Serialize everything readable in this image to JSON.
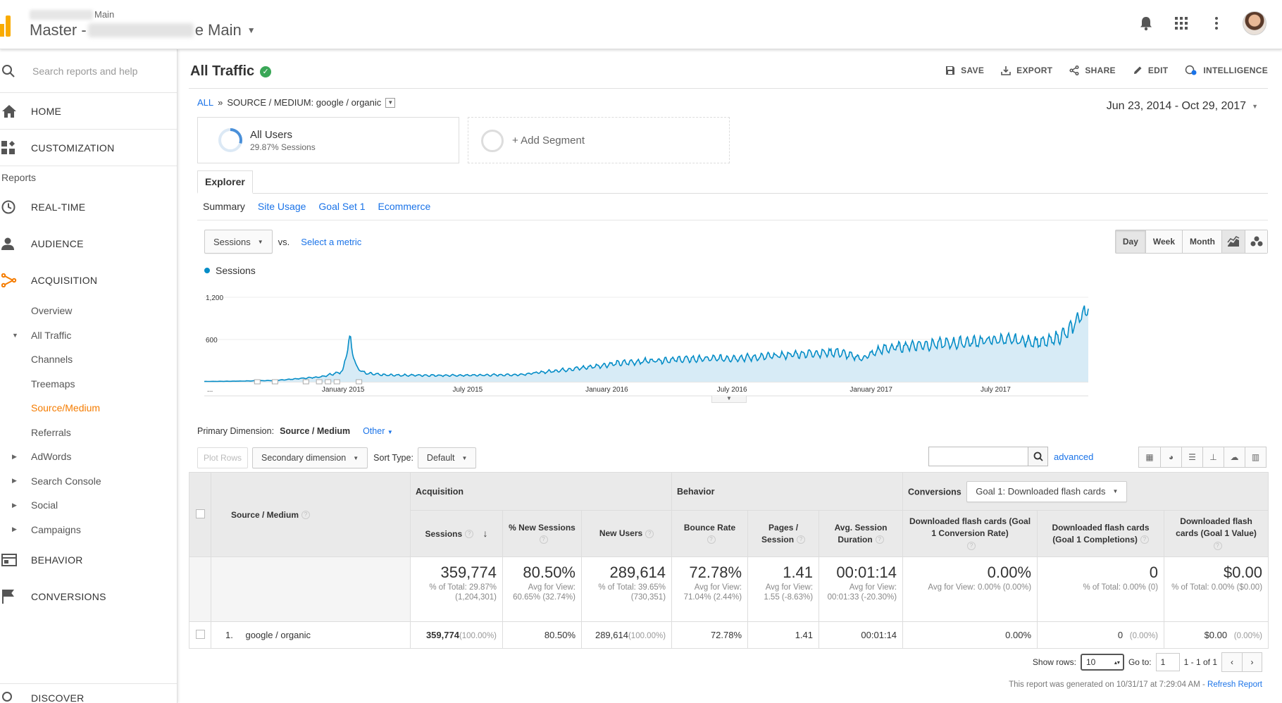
{
  "account": {
    "property_small": "Main",
    "view_prefix": "Master -",
    "view_suffix": "e Main"
  },
  "sidebar": {
    "search_placeholder": "Search reports and help",
    "home": "HOME",
    "customization": "CUSTOMIZATION",
    "reports_label": "Reports",
    "realtime": "REAL-TIME",
    "audience": "AUDIENCE",
    "acquisition": "ACQUISITION",
    "acq_items": [
      "Overview",
      "All Traffic",
      "Channels",
      "Treemaps",
      "Source/Medium",
      "Referrals",
      "AdWords",
      "Search Console",
      "Social",
      "Campaigns"
    ],
    "behavior": "BEHAVIOR",
    "conversions": "CONVERSIONS",
    "discover": "DISCOVER"
  },
  "header": {
    "title": "All Traffic",
    "actions": [
      "SAVE",
      "EXPORT",
      "SHARE",
      "EDIT",
      "INTELLIGENCE"
    ]
  },
  "breadcrumb": {
    "all": "ALL",
    "sep": "»",
    "current": "SOURCE / MEDIUM: google / organic"
  },
  "date_range": "Jun 23, 2014 - Oct 29, 2017",
  "segment": {
    "name": "All Users",
    "sub": "29.87% Sessions",
    "add_label": "+ Add Segment"
  },
  "explorer": {
    "tab": "Explorer",
    "subtabs": [
      "Summary",
      "Site Usage",
      "Goal Set 1",
      "Ecommerce"
    ]
  },
  "metric": {
    "selected": "Sessions",
    "vs": "vs.",
    "select_metric": "Select a metric",
    "periods": [
      "Day",
      "Week",
      "Month"
    ],
    "active_period": "Day"
  },
  "chart_data": {
    "type": "area",
    "series": [
      {
        "name": "Sessions"
      }
    ],
    "y_ticks": [
      "1,200",
      "600"
    ],
    "y_range": [
      0,
      1200
    ],
    "x_labels": [
      "...",
      "January 2015",
      "July 2015",
      "January 2016",
      "July 2016",
      "January 2017",
      "July 2017"
    ],
    "x": [
      "2014-06-23",
      "2014-08-01",
      "2014-10-01",
      "2014-12-01",
      "2015-01-01",
      "2015-01-10",
      "2015-01-15",
      "2015-01-20",
      "2015-02-01",
      "2015-03-01",
      "2015-06-01",
      "2015-09-01",
      "2015-12-01",
      "2016-01-15",
      "2016-03-01",
      "2016-04-15",
      "2016-06-01",
      "2016-08-01",
      "2016-10-01",
      "2016-11-15",
      "2016-12-20",
      "2017-01-15",
      "2017-03-01",
      "2017-05-01",
      "2017-07-01",
      "2017-09-01",
      "2017-10-01",
      "2017-10-15",
      "2017-10-29"
    ],
    "values": [
      5,
      8,
      20,
      70,
      150,
      620,
      430,
      200,
      120,
      95,
      90,
      100,
      200,
      260,
      300,
      320,
      330,
      350,
      400,
      420,
      330,
      460,
      520,
      550,
      600,
      560,
      700,
      900,
      1050
    ],
    "color": "#058dc7",
    "fill": "#d7ebf6",
    "grid": true
  },
  "primary_dimension": {
    "label": "Primary Dimension:",
    "selected": "Source / Medium",
    "other": "Other"
  },
  "table_tools": {
    "plot_rows": "Plot Rows",
    "secondary": "Secondary dimension",
    "sort_type_label": "Sort Type:",
    "sort_type": "Default",
    "advanced": "advanced"
  },
  "table": {
    "groups": {
      "acquisition": "Acquisition",
      "behavior": "Behavior",
      "conversions": "Conversions",
      "goal_select": "Goal 1: Downloaded flash cards"
    },
    "dim_header": "Source / Medium",
    "columns": [
      "Sessions",
      "% New Sessions",
      "New Users",
      "Bounce Rate",
      "Pages / Session",
      "Avg. Session Duration",
      "Downloaded flash cards (Goal 1 Conversion Rate)",
      "Downloaded flash cards (Goal 1 Completions)",
      "Downloaded flash cards (Goal 1 Value)"
    ],
    "totals": [
      {
        "big": "359,774",
        "small": "% of Total: 29.87% (1,204,301)"
      },
      {
        "big": "80.50%",
        "small": "Avg for View: 60.65% (32.74%)"
      },
      {
        "big": "289,614",
        "small": "% of Total: 39.65% (730,351)"
      },
      {
        "big": "72.78%",
        "small": "Avg for View: 71.04% (2.44%)"
      },
      {
        "big": "1.41",
        "small": "Avg for View: 1.55 (-8.63%)"
      },
      {
        "big": "00:01:14",
        "small": "Avg for View: 00:01:33 (-20.30%)"
      },
      {
        "big": "0.00%",
        "small": "Avg for View: 0.00% (0.00%)"
      },
      {
        "big": "0",
        "small": "% of Total: 0.00% (0)"
      },
      {
        "big": "$0.00",
        "small": "% of Total: 0.00% ($0.00)"
      }
    ],
    "rows": [
      {
        "index": "1.",
        "dim": "google / organic",
        "sessions": "359,774",
        "sessions_pct": "(100.00%)",
        "new_sessions": "80.50%",
        "new_users": "289,614",
        "new_users_pct": "(100.00%)",
        "bounce": "72.78%",
        "pages": "1.41",
        "duration": "00:01:14",
        "conv_rate": "0.00%",
        "completions": "0",
        "completions_pct": "(0.00%)",
        "value": "$0.00",
        "value_pct": "(0.00%)"
      }
    ]
  },
  "pager": {
    "show_rows_label": "Show rows:",
    "show_rows": "10",
    "goto_label": "Go to:",
    "goto": "1",
    "range": "1 - 1 of 1"
  },
  "footer": {
    "generated": "This report was generated on 10/31/17 at 7:29:04 AM -",
    "refresh": "Refresh Report"
  }
}
